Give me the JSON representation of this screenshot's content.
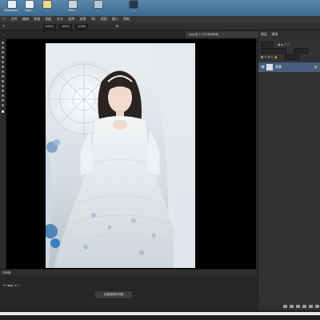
{
  "desktop": {
    "icons": [
      {
        "label": "Windows...",
        "icon": "app-icon"
      },
      {
        "label": "iQiyi...",
        "icon": "app-icon"
      },
      {
        "label": "...",
        "icon": "folder-icon"
      },
      {
        "label": "DSC...",
        "icon": "image-icon"
      },
      {
        "label": "...",
        "icon": "document-icon"
      },
      {
        "label": "...",
        "icon": "app-icon"
      }
    ]
  },
  "menubar": {
    "items": [
      "Ps",
      "文件",
      "编辑",
      "图像",
      "图层",
      "文字",
      "选择",
      "滤镜",
      "3D",
      "视图",
      "窗口",
      "帮助"
    ]
  },
  "optionsbar": {
    "fields": [
      "100%",
      "100%",
      "100%"
    ]
  },
  "tabs": [
    {
      "label": "...",
      "active": false
    },
    {
      "label": "...",
      "active": false
    },
    {
      "label": "...",
      "active": false
    },
    {
      "label": "...",
      "active": false
    },
    {
      "label": "...",
      "active": false
    },
    {
      "label": "...",
      "active": false
    },
    {
      "label": "...jpg @ 17.2%(RGB/8)",
      "active": true
    }
  ],
  "panel": {
    "title": "图层",
    "tab2": "通道",
    "layer_name": "背景"
  },
  "timeline": {
    "title": "时间轴",
    "create_button": "创建视频时间轴"
  },
  "colors": {
    "accent": "#465d7d",
    "canvas": "#000000",
    "desktop_sky": "#4a7aa0"
  }
}
